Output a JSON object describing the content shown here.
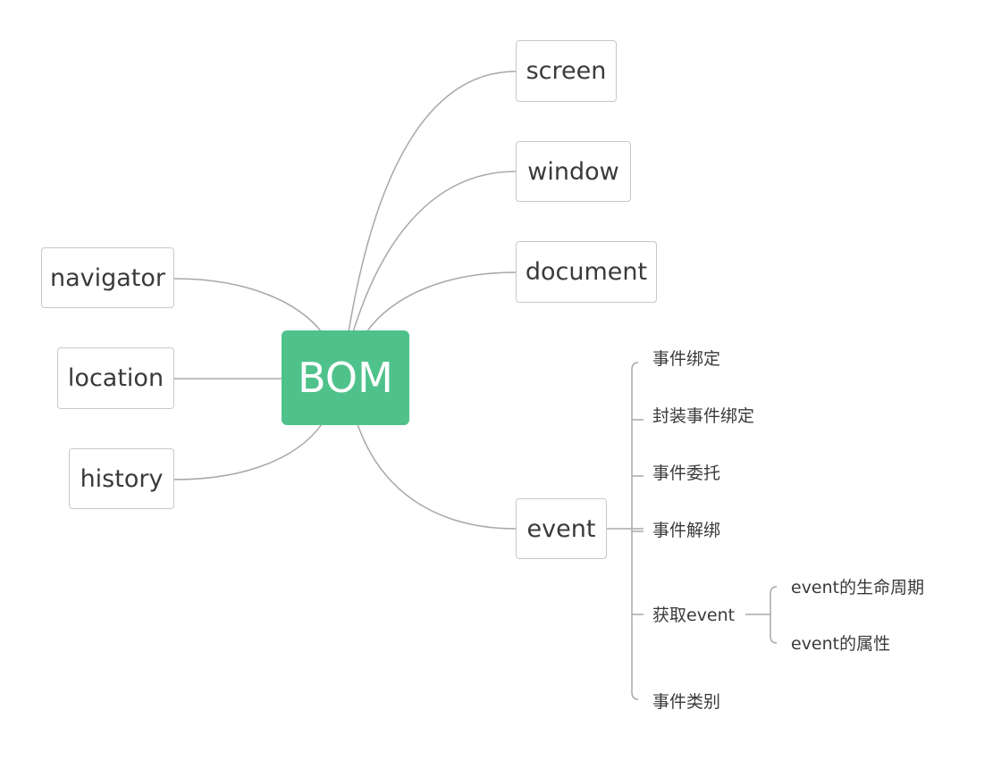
{
  "root": {
    "label": "BOM",
    "color": "#4fc28b"
  },
  "left_nodes": [
    {
      "label": "navigator"
    },
    {
      "label": "location"
    },
    {
      "label": "history"
    }
  ],
  "right_nodes": [
    {
      "label": "screen"
    },
    {
      "label": "window"
    },
    {
      "label": "document"
    },
    {
      "label": "event"
    }
  ],
  "event_children": [
    {
      "label": "事件绑定"
    },
    {
      "label": "封装事件绑定"
    },
    {
      "label": "事件委托"
    },
    {
      "label": "事件解绑"
    },
    {
      "label": "获取event"
    },
    {
      "label": "事件类别"
    }
  ],
  "get_event_children": [
    {
      "label": "event的生命周期"
    },
    {
      "label": "event的属性"
    }
  ],
  "line_color": "#a8a8a8"
}
